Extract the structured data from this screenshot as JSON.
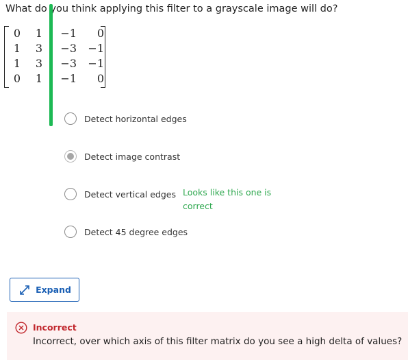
{
  "question": "What do you think applying this filter to a grayscale image will do?",
  "matrix": [
    [
      "0",
      "1",
      "−1",
      "0"
    ],
    [
      "1",
      "3",
      "−3",
      "−1"
    ],
    [
      "1",
      "3",
      "−3",
      "−1"
    ],
    [
      "0",
      "1",
      "−1",
      "0"
    ]
  ],
  "options": [
    {
      "label": "Detect horizontal edges",
      "selected": false
    },
    {
      "label": "Detect image contrast",
      "selected": true
    },
    {
      "label": "Detect vertical edges",
      "selected": false
    },
    {
      "label": "Detect 45 degree edges",
      "selected": false
    }
  ],
  "hint": "Looks like this one is correct",
  "expand_label": "Expand",
  "feedback": {
    "title": "Incorrect",
    "text": "Incorrect, over which axis of this filter matrix do you see a high delta of values?"
  },
  "colors": {
    "accent_green": "#1db954",
    "hint_green": "#2fa84f",
    "link_blue": "#1a5fb4",
    "error_red": "#c1272d",
    "error_bg": "#fdf1f1"
  },
  "icons": {
    "expand": "expand-arrows-icon",
    "feedback": "x-circle-icon"
  }
}
